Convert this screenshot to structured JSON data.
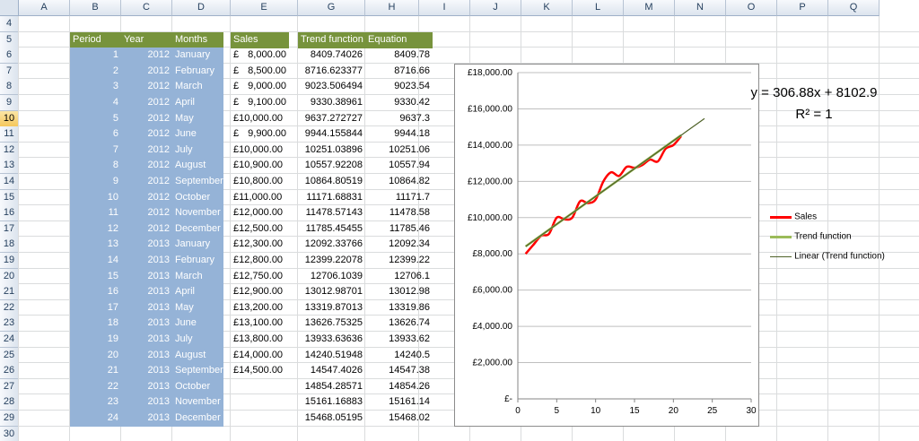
{
  "columns": [
    "A",
    "B",
    "C",
    "D",
    "E",
    "G",
    "H",
    "I",
    "J",
    "K",
    "L",
    "M",
    "N",
    "O",
    "P",
    "Q"
  ],
  "rows": [
    "4",
    "5",
    "6",
    "7",
    "8",
    "9",
    "10",
    "11",
    "12",
    "13",
    "14",
    "15",
    "16",
    "17",
    "18",
    "19",
    "20",
    "21",
    "22",
    "23",
    "24",
    "25",
    "26",
    "27",
    "28",
    "29",
    "30"
  ],
  "selected_row": "10",
  "headers": {
    "period": "Period",
    "year": "Year",
    "months": "Months",
    "sales": "Sales",
    "trend": "Trend function",
    "equation": "Equation"
  },
  "table": [
    {
      "period": "1",
      "year": "2012",
      "month": "January",
      "sales_sym": "£",
      "sales_val": "8,000.00",
      "trend": "8409.74026",
      "eq": "8409.78"
    },
    {
      "period": "2",
      "year": "2012",
      "month": "February",
      "sales_sym": "£",
      "sales_val": "8,500.00",
      "trend": "8716.623377",
      "eq": "8716.66"
    },
    {
      "period": "3",
      "year": "2012",
      "month": "March",
      "sales_sym": "£",
      "sales_val": "9,000.00",
      "trend": "9023.506494",
      "eq": "9023.54"
    },
    {
      "period": "4",
      "year": "2012",
      "month": "April",
      "sales_sym": "£",
      "sales_val": "9,100.00",
      "trend": "9330.38961",
      "eq": "9330.42"
    },
    {
      "period": "5",
      "year": "2012",
      "month": "May",
      "sales_sym": "£10,000.00",
      "sales_val": "",
      "trend": "9637.272727",
      "eq": "9637.3"
    },
    {
      "period": "6",
      "year": "2012",
      "month": "June",
      "sales_sym": "£",
      "sales_val": "9,900.00",
      "trend": "9944.155844",
      "eq": "9944.18"
    },
    {
      "period": "7",
      "year": "2012",
      "month": "July",
      "sales_sym": "£10,000.00",
      "sales_val": "",
      "trend": "10251.03896",
      "eq": "10251.06"
    },
    {
      "period": "8",
      "year": "2012",
      "month": "August",
      "sales_sym": "£10,900.00",
      "sales_val": "",
      "trend": "10557.92208",
      "eq": "10557.94"
    },
    {
      "period": "9",
      "year": "2012",
      "month": "September",
      "sales_sym": "£10,800.00",
      "sales_val": "",
      "trend": "10864.80519",
      "eq": "10864.82"
    },
    {
      "period": "10",
      "year": "2012",
      "month": "October",
      "sales_sym": "£11,000.00",
      "sales_val": "",
      "trend": "11171.68831",
      "eq": "11171.7"
    },
    {
      "period": "11",
      "year": "2012",
      "month": "November",
      "sales_sym": "£12,000.00",
      "sales_val": "",
      "trend": "11478.57143",
      "eq": "11478.58"
    },
    {
      "period": "12",
      "year": "2012",
      "month": "December",
      "sales_sym": "£12,500.00",
      "sales_val": "",
      "trend": "11785.45455",
      "eq": "11785.46"
    },
    {
      "period": "13",
      "year": "2013",
      "month": "January",
      "sales_sym": "£12,300.00",
      "sales_val": "",
      "trend": "12092.33766",
      "eq": "12092.34"
    },
    {
      "period": "14",
      "year": "2013",
      "month": "February",
      "sales_sym": "£12,800.00",
      "sales_val": "",
      "trend": "12399.22078",
      "eq": "12399.22"
    },
    {
      "period": "15",
      "year": "2013",
      "month": "March",
      "sales_sym": "£12,750.00",
      "sales_val": "",
      "trend": "12706.1039",
      "eq": "12706.1"
    },
    {
      "period": "16",
      "year": "2013",
      "month": "April",
      "sales_sym": "£12,900.00",
      "sales_val": "",
      "trend": "13012.98701",
      "eq": "13012.98"
    },
    {
      "period": "17",
      "year": "2013",
      "month": "May",
      "sales_sym": "£13,200.00",
      "sales_val": "",
      "trend": "13319.87013",
      "eq": "13319.86"
    },
    {
      "period": "18",
      "year": "2013",
      "month": "June",
      "sales_sym": "£13,100.00",
      "sales_val": "",
      "trend": "13626.75325",
      "eq": "13626.74"
    },
    {
      "period": "19",
      "year": "2013",
      "month": "July",
      "sales_sym": "£13,800.00",
      "sales_val": "",
      "trend": "13933.63636",
      "eq": "13933.62"
    },
    {
      "period": "20",
      "year": "2013",
      "month": "August",
      "sales_sym": "£14,000.00",
      "sales_val": "",
      "trend": "14240.51948",
      "eq": "14240.5"
    },
    {
      "period": "21",
      "year": "2013",
      "month": "September",
      "sales_sym": "£14,500.00",
      "sales_val": "",
      "trend": "14547.4026",
      "eq": "14547.38"
    },
    {
      "period": "22",
      "year": "2013",
      "month": "October",
      "sales_sym": "",
      "sales_val": "",
      "trend": "14854.28571",
      "eq": "14854.26"
    },
    {
      "period": "23",
      "year": "2013",
      "month": "November",
      "sales_sym": "",
      "sales_val": "",
      "trend": "15161.16883",
      "eq": "15161.14"
    },
    {
      "period": "24",
      "year": "2013",
      "month": "December",
      "sales_sym": "",
      "sales_val": "",
      "trend": "15468.05195",
      "eq": "15468.02"
    }
  ],
  "chart_data": {
    "type": "line",
    "x": [
      1,
      2,
      3,
      4,
      5,
      6,
      7,
      8,
      9,
      10,
      11,
      12,
      13,
      14,
      15,
      16,
      17,
      18,
      19,
      20,
      21
    ],
    "series": [
      {
        "name": "Sales",
        "color": "#ff0000",
        "values": [
          8000,
          8500,
          9000,
          9100,
          10000,
          9900,
          10000,
          10900,
          10800,
          11000,
          12000,
          12500,
          12300,
          12800,
          12750,
          12900,
          13200,
          13100,
          13800,
          14000,
          14500
        ]
      },
      {
        "name": "Trend function",
        "color": "#9bbb59",
        "x": [
          1,
          21
        ],
        "values": [
          8409.74026,
          14547.4026
        ]
      },
      {
        "name": "Linear (Trend function)",
        "color": "#4f6228",
        "x": [
          1,
          24
        ],
        "values": [
          8409.74026,
          15468.05195
        ]
      }
    ],
    "xlim": [
      0,
      30
    ],
    "ylim": [
      0,
      18000
    ],
    "x_ticks": [
      "0",
      "5",
      "10",
      "15",
      "20",
      "25",
      "30"
    ],
    "y_ticks": [
      "£-",
      "£2,000.00",
      "£4,000.00",
      "£6,000.00",
      "£8,000.00",
      "£10,000.00",
      "£12,000.00",
      "£14,000.00",
      "£16,000.00",
      "£18,000.00"
    ],
    "annotation_line1": "y = 306.88x + 8102.9",
    "annotation_line2": "R² = 1",
    "legend_position": "right",
    "grid": true
  }
}
